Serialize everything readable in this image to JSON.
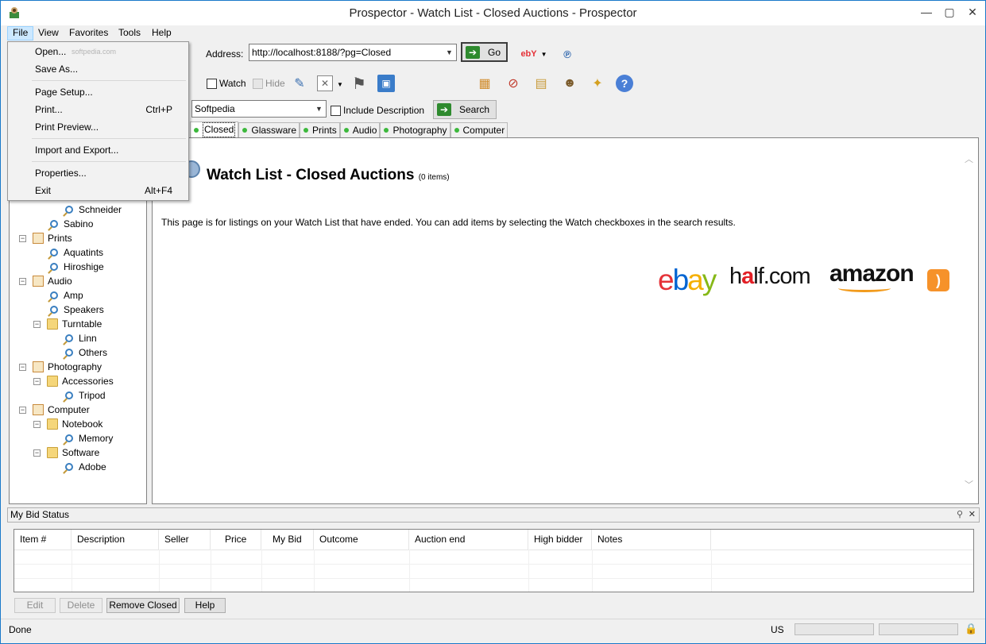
{
  "window": {
    "title": "Prospector - Watch List - Closed Auctions - Prospector",
    "minimize": "—",
    "maximize": "▢",
    "close": "✕"
  },
  "menubar": {
    "items": [
      "File",
      "View",
      "Favorites",
      "Tools",
      "Help"
    ]
  },
  "file_menu": {
    "items": [
      {
        "label": "Open...",
        "shortcut": ""
      },
      {
        "label": "Save As...",
        "shortcut": ""
      },
      {
        "label": "Page Setup...",
        "shortcut": ""
      },
      {
        "label": "Print...",
        "shortcut": "Ctrl+P"
      },
      {
        "label": "Print Preview...",
        "shortcut": ""
      },
      {
        "label": "Import and Export...",
        "shortcut": ""
      },
      {
        "label": "Properties...",
        "shortcut": ""
      },
      {
        "label": "Exit",
        "shortcut": "Alt+F4"
      }
    ]
  },
  "toolbar": {
    "address_label": "Address:",
    "address_value": "http://localhost:8188/?pg=Closed",
    "go_label": "Go",
    "watch_label": "Watch",
    "hide_label": "Hide",
    "search_value": "Softpedia",
    "include_description_label": "Include Description",
    "search_label": "Search",
    "ebay_label": "ebY"
  },
  "tabs": [
    {
      "label": "Closed",
      "active": true
    },
    {
      "label": "Glassware",
      "active": false
    },
    {
      "label": "Prints",
      "active": false
    },
    {
      "label": "Audio",
      "active": false
    },
    {
      "label": "Photography",
      "active": false
    },
    {
      "label": "Computer",
      "active": false
    }
  ],
  "tree": [
    {
      "label": "Schneider",
      "type": "search",
      "level": 2,
      "expander": ""
    },
    {
      "label": "Sabino",
      "type": "search",
      "level": 1,
      "expander": ""
    },
    {
      "label": "Prints",
      "type": "doc",
      "level": 0,
      "expander": "−"
    },
    {
      "label": "Aquatints",
      "type": "search",
      "level": 1,
      "expander": ""
    },
    {
      "label": "Hiroshige",
      "type": "search",
      "level": 1,
      "expander": ""
    },
    {
      "label": "Audio",
      "type": "doc",
      "level": 0,
      "expander": "−"
    },
    {
      "label": "Amp",
      "type": "search",
      "level": 1,
      "expander": ""
    },
    {
      "label": "Speakers",
      "type": "search",
      "level": 1,
      "expander": ""
    },
    {
      "label": "Turntable",
      "type": "folder",
      "level": 1,
      "expander": "−"
    },
    {
      "label": "Linn",
      "type": "search",
      "level": 2,
      "expander": ""
    },
    {
      "label": "Others",
      "type": "search",
      "level": 2,
      "expander": ""
    },
    {
      "label": "Photography",
      "type": "doc",
      "level": 0,
      "expander": "−"
    },
    {
      "label": "Accessories",
      "type": "folder",
      "level": 1,
      "expander": "−"
    },
    {
      "label": "Tripod",
      "type": "search",
      "level": 2,
      "expander": ""
    },
    {
      "label": "Computer",
      "type": "doc",
      "level": 0,
      "expander": "−"
    },
    {
      "label": "Notebook",
      "type": "folder",
      "level": 1,
      "expander": "−"
    },
    {
      "label": "Memory",
      "type": "search",
      "level": 2,
      "expander": ""
    },
    {
      "label": "Software",
      "type": "folder",
      "level": 1,
      "expander": "−"
    },
    {
      "label": "Adobe",
      "type": "search",
      "level": 2,
      "expander": ""
    }
  ],
  "content": {
    "heading": "Watch List - Closed Auctions",
    "count": "(0 items)",
    "description": "This page is for listings on your Watch List that have ended. You can add items by selecting the Watch checkboxes in the search results.",
    "logos": {
      "ebay": [
        "e",
        "b",
        "a",
        "y"
      ],
      "ebay_colors": [
        "#e53238",
        "#0064d2",
        "#f5af02",
        "#86b817"
      ],
      "half_a": "h",
      "half_b": "a",
      "half_c": "lf.com",
      "amazon": "amazon",
      "rss": ")"
    }
  },
  "bid_status": {
    "title": "My Bid Status",
    "columns": [
      "Item #",
      "Description",
      "Seller",
      "Price",
      "My Bid",
      "Outcome",
      "Auction end",
      "High bidder",
      "Notes"
    ],
    "buttons": {
      "edit": "Edit",
      "delete": "Delete",
      "remove_closed": "Remove Closed",
      "help": "Help"
    }
  },
  "statusbar": {
    "text": "Done",
    "locale": "US"
  },
  "watermark": "softpedia.com"
}
